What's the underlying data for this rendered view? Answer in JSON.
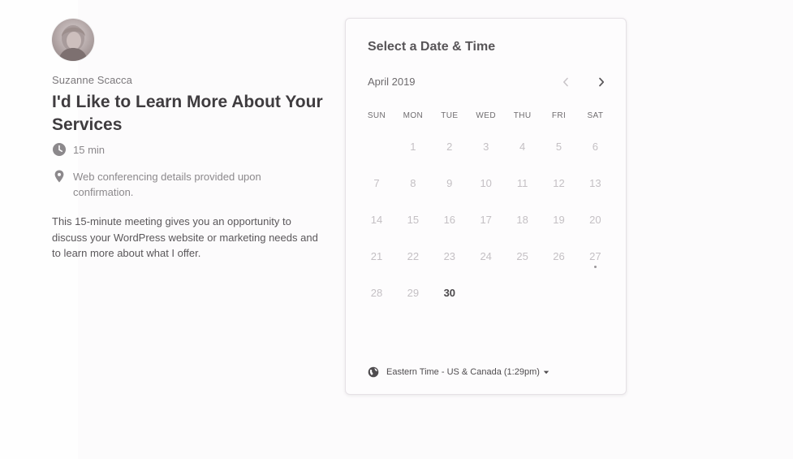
{
  "host": {
    "name": "Suzanne Scacca"
  },
  "event": {
    "title": "I'd Like to Learn More About Your Services",
    "duration": "15 min",
    "location": "Web conferencing details provided upon confirmation.",
    "description": "This 15-minute meeting gives you an opportunity to discuss your WordPress website or marketing needs and to learn more about what I offer."
  },
  "icons": {
    "duration": "clock-icon",
    "location": "map-pin-icon",
    "prev": "chevron-left-icon",
    "next": "chevron-right-icon",
    "timezone": "globe-icon",
    "dropdown": "caret-down-icon"
  },
  "calendar": {
    "heading": "Select a Date & Time",
    "month": "April 2019",
    "weekdays": [
      "SUN",
      "MON",
      "TUE",
      "WED",
      "THU",
      "FRI",
      "SAT"
    ],
    "weeks": [
      [
        "",
        "1",
        "2",
        "3",
        "4",
        "5",
        "6"
      ],
      [
        "7",
        "8",
        "9",
        "10",
        "11",
        "12",
        "13"
      ],
      [
        "14",
        "15",
        "16",
        "17",
        "18",
        "19",
        "20"
      ],
      [
        "21",
        "22",
        "23",
        "24",
        "25",
        "26",
        "27"
      ],
      [
        "28",
        "29",
        "30",
        "",
        "",
        "",
        ""
      ]
    ],
    "today": "27",
    "available_dates": [
      "30"
    ],
    "timezone": "Eastern Time - US & Canada (1:29pm)"
  },
  "colors": {
    "text_dark": "#3f3c3f",
    "text_muted": "#8c898c",
    "date_disabled": "#c4c0c4",
    "date_available": "#4a474a",
    "card_border": "#e6e1e6"
  }
}
